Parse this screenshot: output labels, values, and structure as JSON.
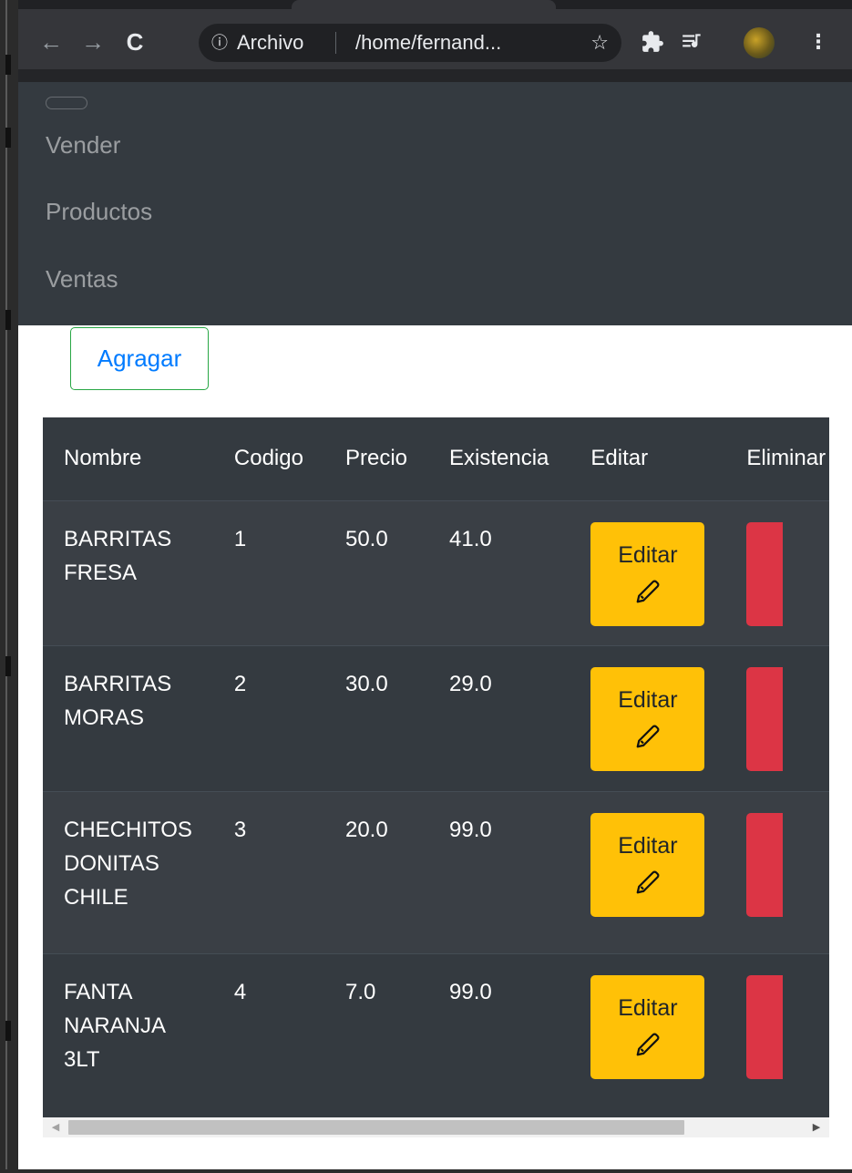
{
  "browser": {
    "info_icon": "info-icon",
    "scheme_label": "Archivo",
    "url": "/home/fernand...",
    "icons": [
      "back-arrow-icon",
      "forward-arrow-icon",
      "reload-icon",
      "star-icon",
      "extensions-puzzle-icon",
      "media-controls-icon",
      "profile-avatar",
      "menu-dots-icon"
    ]
  },
  "navbar": {
    "links": [
      {
        "label": "Vender"
      },
      {
        "label": "Productos"
      },
      {
        "label": "Ventas"
      }
    ]
  },
  "actions": {
    "add_label": "Agragar"
  },
  "table": {
    "headers": [
      "Nombre",
      "Codigo",
      "Precio",
      "Existencia",
      "Editar",
      "Eliminar"
    ],
    "rows": [
      {
        "nombre": "BARRITAS FRESA",
        "codigo": "1",
        "precio": "50.0",
        "existencia": "41.0",
        "edit_label": "Editar"
      },
      {
        "nombre": "BARRITAS MORAS",
        "codigo": "2",
        "precio": "30.0",
        "existencia": "29.0",
        "edit_label": "Editar"
      },
      {
        "nombre": "CHECHITOS DONITAS CHILE",
        "codigo": "3",
        "precio": "20.0",
        "existencia": "99.0",
        "edit_label": "Editar"
      },
      {
        "nombre": "FANTA NARANJA 3LT",
        "codigo": "4",
        "precio": "7.0",
        "existencia": "99.0",
        "edit_label": "Editar"
      }
    ]
  },
  "colors": {
    "navbar_bg": "#343a40",
    "edit_button": "#ffc107",
    "delete_button": "#dc3545",
    "add_button_border": "#28a745",
    "add_button_text": "#007bff"
  }
}
